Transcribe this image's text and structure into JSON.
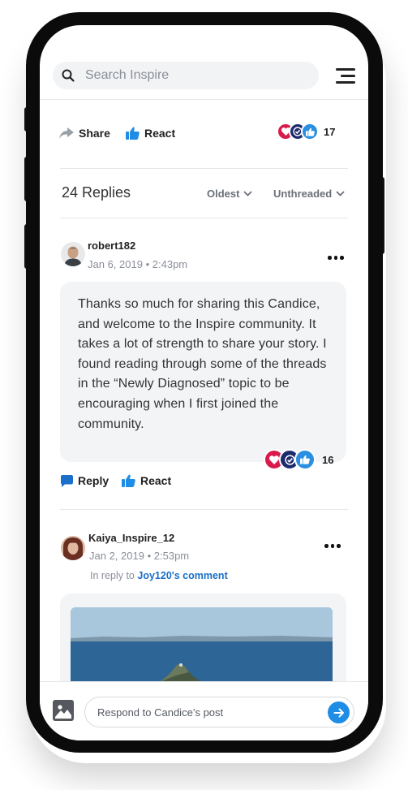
{
  "search": {
    "placeholder": "Search Inspire"
  },
  "post_actions": {
    "share_label": "Share",
    "react_label": "React",
    "reaction_count": "17"
  },
  "replies": {
    "title": "24 Replies",
    "sort_order": "Oldest",
    "thread_mode": "Unthreaded"
  },
  "comments": [
    {
      "username": "robert182",
      "date": "Jan 6, 2019",
      "time": "2:43pm",
      "body": "Thanks so much for sharing this Candice, and welcome to the Inspire community. It takes a lot of strength to share your story. I found reading through some of the threads in the “Newly Diagnosed” topic to be encouraging when I first joined the community.",
      "reaction_count": "16",
      "reply_label": "Reply",
      "react_label": "React"
    },
    {
      "username": "Kaiya_Inspire_12",
      "date": "Jan 2, 2019",
      "time": "2:53pm",
      "in_reply_prefix": "In reply to",
      "in_reply_target": "Joy120's comment"
    }
  ],
  "composer": {
    "placeholder": "Respond to Candice’s post"
  },
  "colors": {
    "accent": "#1f8ce6",
    "heart": "#d81b4a",
    "check": "#1e2a6e",
    "like": "#2a8fe0",
    "link": "#1b6fc9"
  },
  "icons": [
    "search-icon",
    "menu-icon",
    "share-icon",
    "thumbs-up-icon",
    "heart-icon",
    "check-icon",
    "chevron-down-icon",
    "more-icon",
    "speech-bubble-icon",
    "image-icon",
    "arrow-right-icon"
  ]
}
